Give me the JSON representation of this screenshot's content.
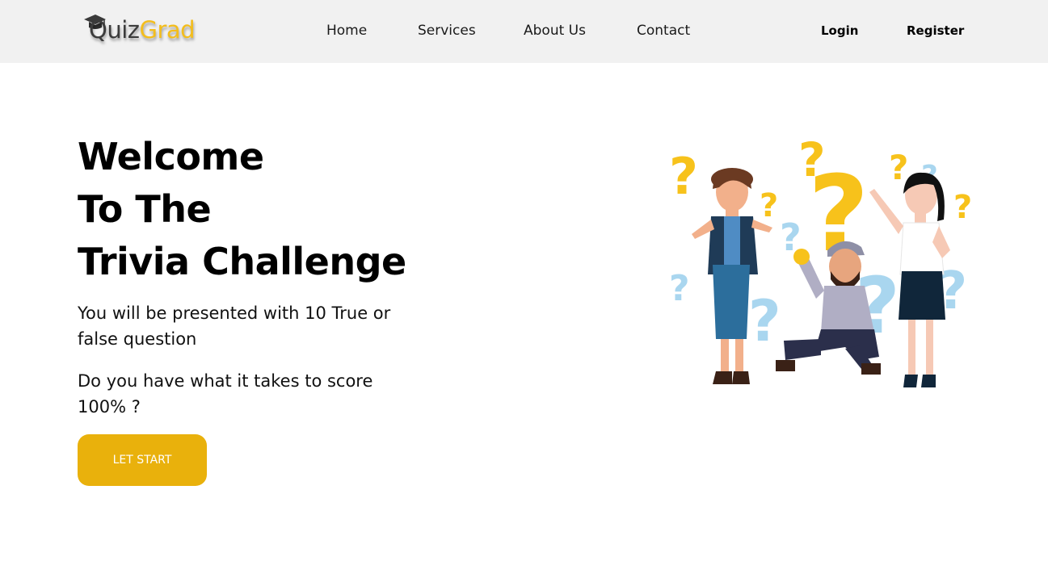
{
  "brand": {
    "part1": "Quiz",
    "part2": "Grad"
  },
  "nav": {
    "items": [
      {
        "label": "Home"
      },
      {
        "label": "Services"
      },
      {
        "label": "About Us"
      },
      {
        "label": "Contact"
      }
    ],
    "login": "Login",
    "register": "Register"
  },
  "hero": {
    "title_lines": [
      "Welcome",
      "To The",
      "Trivia Challenge"
    ],
    "description": "You will be presented with 10 True or false question",
    "question": "Do you have what it takes to score 100% ?",
    "cta_label": "LET START"
  },
  "colors": {
    "accent": "#e9b10c",
    "logo_grad": "#f3bd1c",
    "navbar_bg": "#f1f1f1",
    "question_yellow": "#f7c21b",
    "question_blue": "#a9d6ef"
  }
}
